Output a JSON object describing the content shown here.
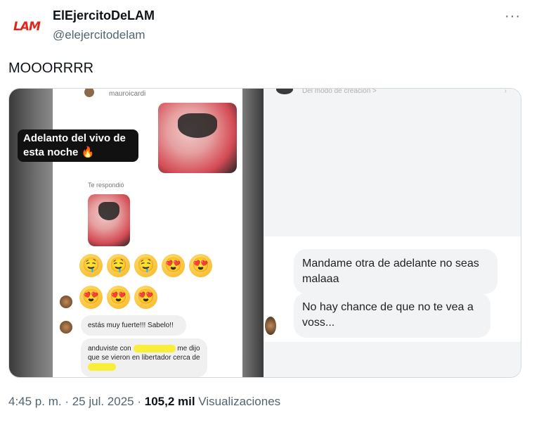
{
  "header": {
    "logo_text": "LAM",
    "display_name": "ElEjercitoDeLAM",
    "handle": "@elejercitodelam",
    "more_glyph": "···"
  },
  "tweet": {
    "text": "MOOORRRR"
  },
  "media": {
    "left": {
      "username": "mauroicardi",
      "promo_label": "Adelanto del vivo de esta noche 🔥",
      "replied_label": "Te respondió",
      "emoji_row1": [
        "🤤",
        "🤤",
        "🤤",
        "😍",
        "😍"
      ],
      "emoji_row2": [
        "😍",
        "😍",
        "😍"
      ],
      "msg1": "estás muy fuerte!!! Sabelo!!",
      "msg2_a": "anduviste con",
      "msg2_b": "me dijo que se vieron en libertador cerca de"
    },
    "right": {
      "creator_label": "Del modo de creación >",
      "msg1": "Mandame otra de adelante no seas malaaa",
      "msg2": "No hay chance de que no te vea a voss..."
    }
  },
  "footer": {
    "time": "4:45 p. m.",
    "date": "25 jul. 2025",
    "views_count": "105,2 mil",
    "views_label": "Visualizaciones"
  },
  "colors": {
    "brand_red": "#e0251b",
    "text_primary": "#0f1419",
    "text_secondary": "#536471",
    "highlight_yellow": "#f7ef3a"
  }
}
